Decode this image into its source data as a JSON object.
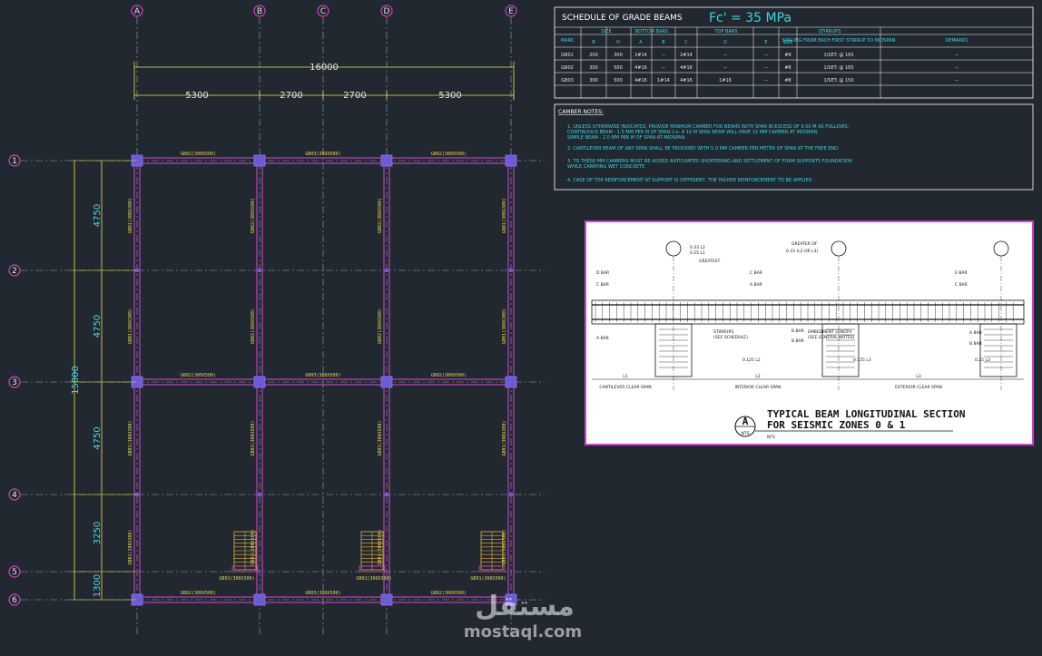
{
  "grid": {
    "columns": [
      "A",
      "B",
      "C",
      "D",
      "E"
    ],
    "rows": [
      "1",
      "2",
      "3",
      "4",
      "5",
      "6"
    ]
  },
  "dimensions": {
    "overall_x": "16000",
    "spans_x": [
      "5300",
      "2700",
      "2700",
      "5300"
    ],
    "overall_y": "15800",
    "spans_y": [
      "4750",
      "4750",
      "4750",
      "3250",
      "1300"
    ]
  },
  "beams": {
    "top_row": [
      "GB02(300X500)",
      "GB03(300X500)",
      "GB02(300X500)"
    ],
    "mid_row": [
      "GB02(300X500)",
      "GB03(300X500)",
      "GB02(300X500)"
    ],
    "bottom_row": [
      "GB02(300X500)",
      "GB03(300X500)",
      "GB02(300X500)"
    ],
    "stair_row": [
      "GB01(300X300)",
      "GB01(300X300)",
      "GB01(300X300)"
    ],
    "verticals": [
      "GB01(300X300)",
      "GB02(300X500)"
    ]
  },
  "schedule": {
    "title": "SCHEDULE OF GRADE BEAMS",
    "fc": "Fc' = 35 MPa",
    "headers": {
      "mark": "MARK",
      "size": "SIZE",
      "bottom_bars": "BOTTOM BARS",
      "top_bars": "TOP BARS",
      "stirrups": "STIRRUPS",
      "remarks": "REMARKS",
      "b": "B",
      "h": "H",
      "a": "A",
      "bb": "B",
      "c": "C",
      "d": "D",
      "e": "E",
      "st_size": "SIZE",
      "spacing": "SPACING FROM EACH FIRST STIRRUP TO MIDSPAN"
    },
    "rows": [
      {
        "mark": "GB01",
        "b": "200",
        "h": "300",
        "a": "2#14",
        "bb": "--",
        "c": "2#14",
        "d": "--",
        "e": "--",
        "size": "#8",
        "spacing": "1/SET: @ 165",
        "remarks": "--"
      },
      {
        "mark": "GB02",
        "b": "300",
        "h": "500",
        "a": "4#16",
        "bb": "--",
        "c": "4#16",
        "d": "--",
        "e": "--",
        "size": "#8",
        "spacing": "1/SET: @ 165",
        "remarks": "--"
      },
      {
        "mark": "GB03",
        "b": "300",
        "h": "500",
        "a": "4#16",
        "bb": "1#14",
        "c": "4#16",
        "d": "1#16",
        "e": "--",
        "size": "#8",
        "spacing": "1/SET: @ 150",
        "remarks": "--"
      }
    ]
  },
  "notes": {
    "title": "CAMBER NOTES:",
    "items": [
      "1.   UNLESS OTHERWISE INDICATED, PROVIDE MINIMUM CAMBER FOR BEAMS WITH SPAN IN EXCESS OF 6.00 M AS FOLLOWS:",
      "      CONTINUOUS BEAM  -  1.5 MM PER M OF SPAN (i.e. A 10 M SPAN BEAM WILL HAVE 15 MM CAMBER AT MIDSPAN.",
      "      SIMPLE BEAM        -  2.0 MM PER M OF SPAN AT MIDSPAN.",
      "2.   CANTILEVER BEAM OF ANY SPAN SHALL BE PROVIDED WITH 5.0 MM CAMBER PER METER OF SPAN AT THE FREE END.",
      "3.   TO THESE MM CAMBERS MUST BE ADDED ANTICIPATED SHORTENING AND SETTLEMENT OF FORM SUPPORTS FOUNDATION",
      "      WHILE CARRYING WET CONCRETE.",
      "4.   CASE OF TOP REINFORCEMENT AT SUPPORT IS DIFFERENT, THE HIGHER REINFORCEMENT TO BE APPLIED."
    ]
  },
  "detail": {
    "title_line1": "TYPICAL BEAM LONGITUDINAL SECTION",
    "title_line2": "FOR SEISMIC ZONES 0 & 1",
    "marker": "A",
    "marker_sub": "NTS",
    "spans": [
      "CANTILEVER CLEAR SPAN",
      "INTERIOR CLEAR SPAN",
      "EXTERIOR CLEAR SPAN"
    ],
    "span_marks": [
      "L1",
      "L2",
      "L3"
    ],
    "labels_left": [
      "D BAR",
      "C BAR",
      "A BAR"
    ],
    "labels_mid": [
      "B BAR",
      "C BAR",
      "A BAR",
      "B BAR"
    ],
    "labels_right": [
      "E BAR",
      "C BAR",
      "A BAR",
      "B BAR"
    ],
    "callouts": [
      "0.33 L2",
      "0.25 L1",
      "GREATEST",
      "GREATER OF",
      "0.33 (L2 OR L3)",
      "STIRRUPS",
      "(SEE SCHEDULE)",
      "EMBEDMENT LENGTH",
      "(SEE GENERAL NOTES)",
      "0.125 L2",
      "0.125 L3",
      "0.25 L3"
    ]
  },
  "watermark": {
    "arabic": "مستقل",
    "latin": "mostaql.com"
  },
  "colors": {
    "background": "#212830",
    "beam": "#d040d0",
    "column": "#6b5bd6",
    "grid_line": "#9aa3ad",
    "dimension": "#f0e040",
    "text_cyan": "#3ad6e0",
    "bubble": "#d040d0"
  }
}
